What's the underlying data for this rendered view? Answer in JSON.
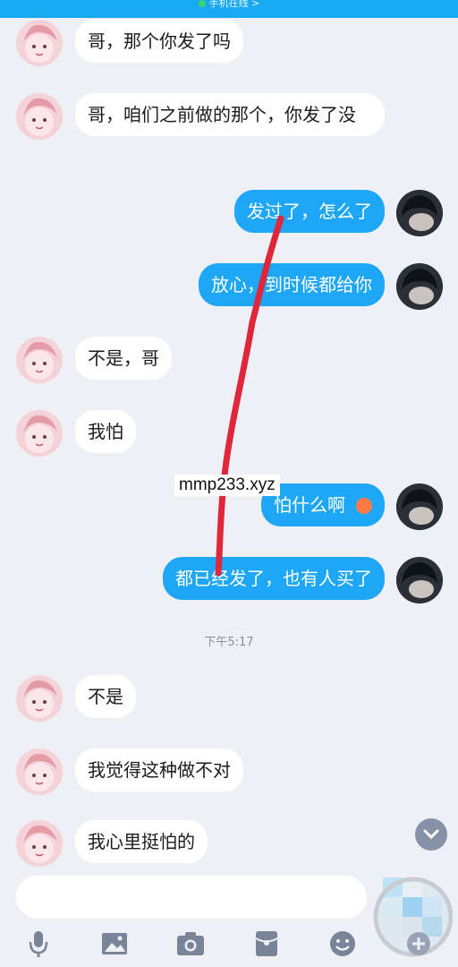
{
  "status": {
    "text": "手机在线 >"
  },
  "messages": [
    {
      "side": "in",
      "text": "哥，那个你发了吗"
    },
    {
      "side": "in",
      "text": "哥，咱们之前做的那个，你发了没"
    },
    {
      "side": "out",
      "text": "发过了，怎么了"
    },
    {
      "side": "out",
      "text": "放心，到时候都给你"
    },
    {
      "side": "in",
      "text": "不是，哥"
    },
    {
      "side": "in",
      "text": "我怕"
    },
    {
      "side": "out",
      "text": "怕什么啊"
    },
    {
      "side": "out",
      "text": "都已经发了，也有人买了"
    },
    {
      "side": "in",
      "text": "不是"
    },
    {
      "side": "in",
      "text": "我觉得这种做不对"
    },
    {
      "side": "in",
      "text": "我心里挺怕的"
    }
  ],
  "timestamp": "下午5:17",
  "watermark": "mmp233.xyz",
  "input": {
    "value": ""
  },
  "toolbar": [
    "mic-icon",
    "image-icon",
    "camera-icon",
    "red-packet-icon",
    "emoji-icon",
    "plus-icon"
  ],
  "colors": {
    "header": "#19a9f3",
    "bubble_out": "#1ea6f7",
    "bubble_in": "#ffffff",
    "background": "#eef0f6",
    "annotation": "#e0263a"
  }
}
